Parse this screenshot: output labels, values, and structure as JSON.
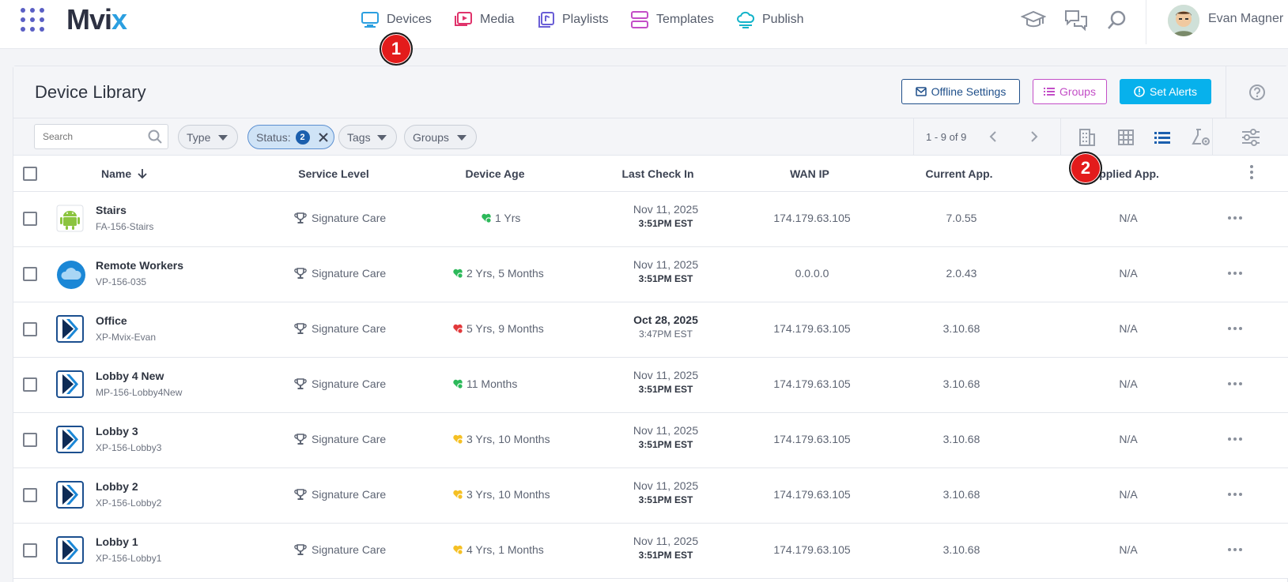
{
  "nav": {
    "brand": "Mvix",
    "items": [
      {
        "label": "Devices",
        "icon": "monitor-icon",
        "color": "#2b9fe0"
      },
      {
        "label": "Media",
        "icon": "media-play-icon",
        "color": "#e0336b"
      },
      {
        "label": "Playlists",
        "icon": "playlist-icon",
        "color": "#6a5ed6"
      },
      {
        "label": "Templates",
        "icon": "templates-icon",
        "color": "#c34ec7"
      },
      {
        "label": "Publish",
        "icon": "cloud-publish-icon",
        "color": "#12b3c9"
      }
    ],
    "user_name": "Evan Magner"
  },
  "markers": {
    "first": "1",
    "second": "2"
  },
  "page": {
    "title": "Device Library",
    "buttons": {
      "offline_settings": "Offline Settings",
      "groups": "Groups",
      "set_alerts": "Set Alerts"
    }
  },
  "filters": {
    "search_placeholder": "Search",
    "type": "Type",
    "status": "Status:",
    "status_count": "2",
    "tags": "Tags",
    "groups": "Groups"
  },
  "pager": {
    "text": "1 - 9 of 9"
  },
  "columns": {
    "name": "Name",
    "service_level": "Service Level",
    "device_age": "Device Age",
    "last_check_in": "Last Check In",
    "wan_ip": "WAN IP",
    "current_app": "Current App.",
    "applied_app": "Applied App."
  },
  "rows": [
    {
      "name": "Stairs",
      "id": "FA-156-Stairs",
      "icon": "android-icon",
      "service": "Signature Care",
      "age": "1 Yrs",
      "age_status": "green",
      "date": "Nov 11, 2025",
      "time": "3:51PM EST",
      "wan": "174.179.63.105",
      "current": "7.0.55",
      "applied": "N/A"
    },
    {
      "name": "Remote Workers",
      "id": "VP-156-035",
      "icon": "cloud-icon",
      "service": "Signature Care",
      "age": "2 Yrs, 5 Months",
      "age_status": "green",
      "date": "Nov 11, 2025",
      "time": "3:51PM EST",
      "wan": "0.0.0.0",
      "current": "2.0.43",
      "applied": "N/A"
    },
    {
      "name": "Office",
      "id": "XP-Mvix-Evan",
      "icon": "mvix-player-icon",
      "service": "Signature Care",
      "age": "5 Yrs, 9 Months",
      "age_status": "red",
      "date": "Oct 28, 2025",
      "time": "3:47PM EST",
      "wan": "174.179.63.105",
      "current": "3.10.68",
      "applied": "N/A"
    },
    {
      "name": "Lobby 4 New",
      "id": "MP-156-Lobby4New",
      "icon": "mvix-player-icon",
      "service": "Signature Care",
      "age": "11 Months",
      "age_status": "green",
      "date": "Nov 11, 2025",
      "time": "3:51PM EST",
      "wan": "174.179.63.105",
      "current": "3.10.68",
      "applied": "N/A"
    },
    {
      "name": "Lobby 3",
      "id": "XP-156-Lobby3",
      "icon": "mvix-player-icon",
      "service": "Signature Care",
      "age": "3 Yrs, 10 Months",
      "age_status": "yellow",
      "date": "Nov 11, 2025",
      "time": "3:51PM EST",
      "wan": "174.179.63.105",
      "current": "3.10.68",
      "applied": "N/A"
    },
    {
      "name": "Lobby 2",
      "id": "XP-156-Lobby2",
      "icon": "mvix-player-icon",
      "service": "Signature Care",
      "age": "3 Yrs, 10 Months",
      "age_status": "yellow",
      "date": "Nov 11, 2025",
      "time": "3:51PM EST",
      "wan": "174.179.63.105",
      "current": "3.10.68",
      "applied": "N/A"
    },
    {
      "name": "Lobby 1",
      "id": "XP-156-Lobby1",
      "icon": "mvix-player-icon",
      "service": "Signature Care",
      "age": "4 Yrs, 1 Months",
      "age_status": "yellow",
      "date": "Nov 11, 2025",
      "time": "3:51PM EST",
      "wan": "174.179.63.105",
      "current": "3.10.68",
      "applied": "N/A"
    }
  ],
  "colors": {
    "accent": "#07b1ec",
    "navy": "#1f4f8a",
    "magenta": "#c34ec7",
    "marker_red": "#e31b1b"
  }
}
